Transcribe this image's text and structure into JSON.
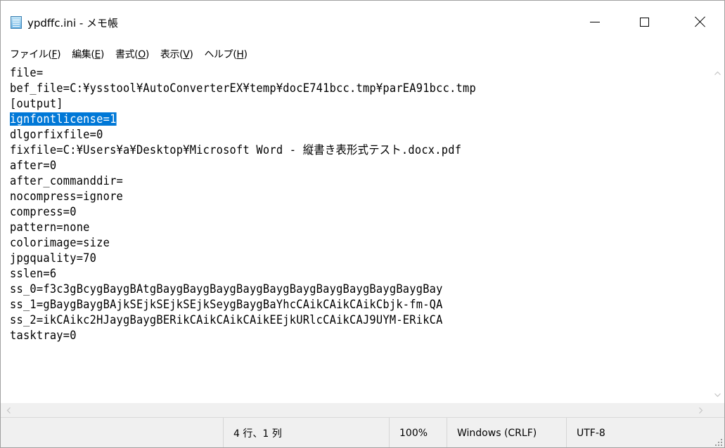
{
  "window": {
    "title": "ypdffc.ini - メモ帳"
  },
  "menu": [
    {
      "label": "ファイル(",
      "accel": "F",
      "close": ")"
    },
    {
      "label": "編集(",
      "accel": "E",
      "close": ")"
    },
    {
      "label": "書式(",
      "accel": "O",
      "close": ")"
    },
    {
      "label": "表示(",
      "accel": "V",
      "close": ")"
    },
    {
      "label": "ヘルプ(",
      "accel": "H",
      "close": ")"
    }
  ],
  "editor": {
    "lines": [
      "file=",
      "bef_file=C:¥ysstool¥AutoConverterEX¥temp¥docE741bcc.tmp¥parEA91bcc.tmp",
      "[output]",
      "ignfontlicense=1",
      "dlgorfixfile=0",
      "fixfile=C:¥Users¥a¥Desktop¥Microsoft Word - 縦書き表形式テスト.docx.pdf",
      "after=0",
      "after_commanddir=",
      "nocompress=ignore",
      "compress=0",
      "pattern=none",
      "colorimage=size",
      "jpgquality=70",
      "sslen=6",
      "ss_0=f3c3gBcygBaygBAtgBaygBaygBaygBaygBaygBaygBaygBaygBaygBaygBay",
      "ss_1=gBaygBaygBAjkSEjkSEjkSEjkSeygBaygBaYhcCAikCAikCAikCbjk-fm-QA",
      "ss_2=ikCAikc2HJaygBaygBERikCAikCAikCAikEEjkURlcCAikCAJ9UYM-ERikCA",
      "tasktray=0"
    ],
    "selected_line": 3,
    "selection_color": "#0078d7"
  },
  "statusbar": {
    "position": "4 行、1 列",
    "zoom": "100%",
    "line_ending": "Windows (CRLF)",
    "encoding": "UTF-8"
  },
  "icons": {
    "app": "notepad-icon",
    "minimize": "minimize-icon",
    "maximize": "maximize-icon",
    "close": "close-icon"
  }
}
